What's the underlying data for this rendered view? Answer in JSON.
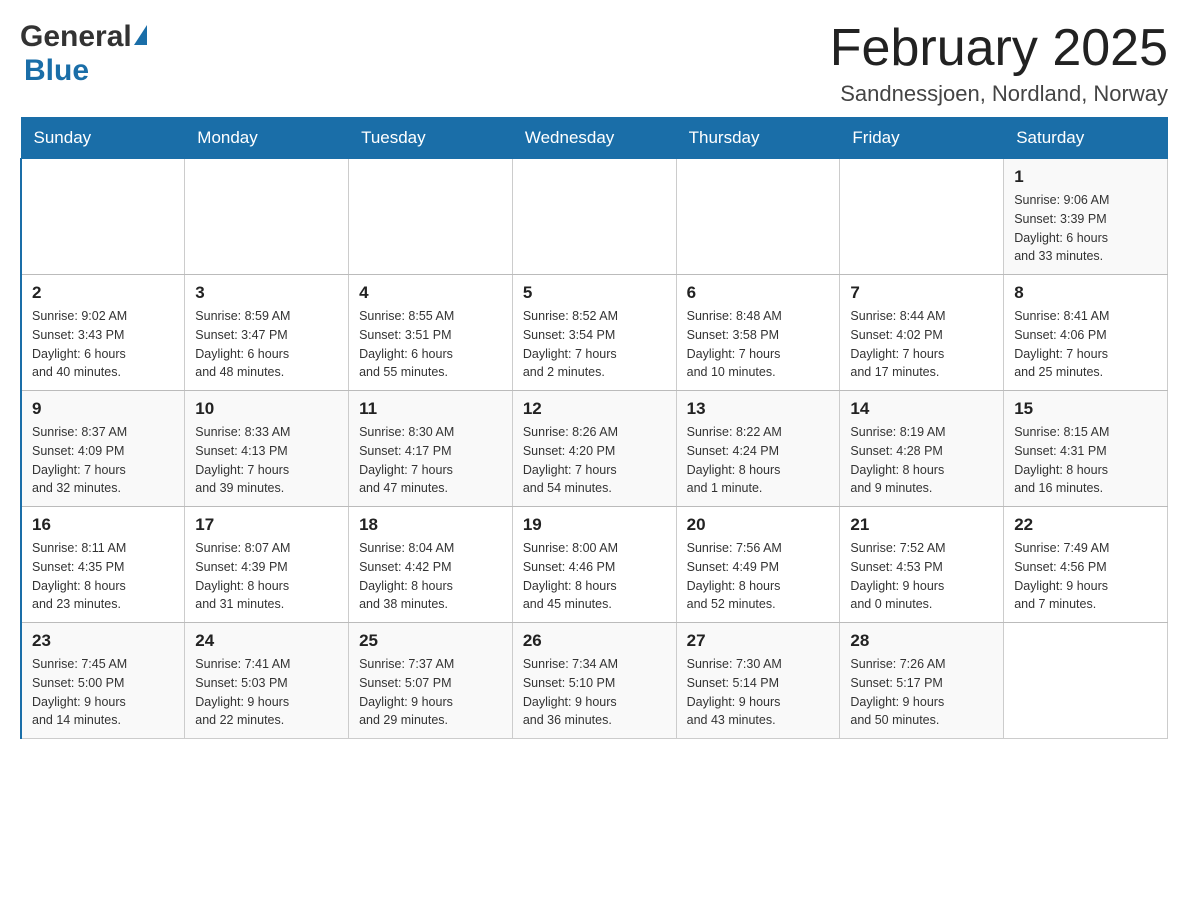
{
  "header": {
    "logo_general": "General",
    "logo_blue": "Blue",
    "title": "February 2025",
    "subtitle": "Sandnessjoen, Nordland, Norway"
  },
  "days_of_week": [
    "Sunday",
    "Monday",
    "Tuesday",
    "Wednesday",
    "Thursday",
    "Friday",
    "Saturday"
  ],
  "weeks": [
    [
      {
        "day": "",
        "info": ""
      },
      {
        "day": "",
        "info": ""
      },
      {
        "day": "",
        "info": ""
      },
      {
        "day": "",
        "info": ""
      },
      {
        "day": "",
        "info": ""
      },
      {
        "day": "",
        "info": ""
      },
      {
        "day": "1",
        "info": "Sunrise: 9:06 AM\nSunset: 3:39 PM\nDaylight: 6 hours\nand 33 minutes."
      }
    ],
    [
      {
        "day": "2",
        "info": "Sunrise: 9:02 AM\nSunset: 3:43 PM\nDaylight: 6 hours\nand 40 minutes."
      },
      {
        "day": "3",
        "info": "Sunrise: 8:59 AM\nSunset: 3:47 PM\nDaylight: 6 hours\nand 48 minutes."
      },
      {
        "day": "4",
        "info": "Sunrise: 8:55 AM\nSunset: 3:51 PM\nDaylight: 6 hours\nand 55 minutes."
      },
      {
        "day": "5",
        "info": "Sunrise: 8:52 AM\nSunset: 3:54 PM\nDaylight: 7 hours\nand 2 minutes."
      },
      {
        "day": "6",
        "info": "Sunrise: 8:48 AM\nSunset: 3:58 PM\nDaylight: 7 hours\nand 10 minutes."
      },
      {
        "day": "7",
        "info": "Sunrise: 8:44 AM\nSunset: 4:02 PM\nDaylight: 7 hours\nand 17 minutes."
      },
      {
        "day": "8",
        "info": "Sunrise: 8:41 AM\nSunset: 4:06 PM\nDaylight: 7 hours\nand 25 minutes."
      }
    ],
    [
      {
        "day": "9",
        "info": "Sunrise: 8:37 AM\nSunset: 4:09 PM\nDaylight: 7 hours\nand 32 minutes."
      },
      {
        "day": "10",
        "info": "Sunrise: 8:33 AM\nSunset: 4:13 PM\nDaylight: 7 hours\nand 39 minutes."
      },
      {
        "day": "11",
        "info": "Sunrise: 8:30 AM\nSunset: 4:17 PM\nDaylight: 7 hours\nand 47 minutes."
      },
      {
        "day": "12",
        "info": "Sunrise: 8:26 AM\nSunset: 4:20 PM\nDaylight: 7 hours\nand 54 minutes."
      },
      {
        "day": "13",
        "info": "Sunrise: 8:22 AM\nSunset: 4:24 PM\nDaylight: 8 hours\nand 1 minute."
      },
      {
        "day": "14",
        "info": "Sunrise: 8:19 AM\nSunset: 4:28 PM\nDaylight: 8 hours\nand 9 minutes."
      },
      {
        "day": "15",
        "info": "Sunrise: 8:15 AM\nSunset: 4:31 PM\nDaylight: 8 hours\nand 16 minutes."
      }
    ],
    [
      {
        "day": "16",
        "info": "Sunrise: 8:11 AM\nSunset: 4:35 PM\nDaylight: 8 hours\nand 23 minutes."
      },
      {
        "day": "17",
        "info": "Sunrise: 8:07 AM\nSunset: 4:39 PM\nDaylight: 8 hours\nand 31 minutes."
      },
      {
        "day": "18",
        "info": "Sunrise: 8:04 AM\nSunset: 4:42 PM\nDaylight: 8 hours\nand 38 minutes."
      },
      {
        "day": "19",
        "info": "Sunrise: 8:00 AM\nSunset: 4:46 PM\nDaylight: 8 hours\nand 45 minutes."
      },
      {
        "day": "20",
        "info": "Sunrise: 7:56 AM\nSunset: 4:49 PM\nDaylight: 8 hours\nand 52 minutes."
      },
      {
        "day": "21",
        "info": "Sunrise: 7:52 AM\nSunset: 4:53 PM\nDaylight: 9 hours\nand 0 minutes."
      },
      {
        "day": "22",
        "info": "Sunrise: 7:49 AM\nSunset: 4:56 PM\nDaylight: 9 hours\nand 7 minutes."
      }
    ],
    [
      {
        "day": "23",
        "info": "Sunrise: 7:45 AM\nSunset: 5:00 PM\nDaylight: 9 hours\nand 14 minutes."
      },
      {
        "day": "24",
        "info": "Sunrise: 7:41 AM\nSunset: 5:03 PM\nDaylight: 9 hours\nand 22 minutes."
      },
      {
        "day": "25",
        "info": "Sunrise: 7:37 AM\nSunset: 5:07 PM\nDaylight: 9 hours\nand 29 minutes."
      },
      {
        "day": "26",
        "info": "Sunrise: 7:34 AM\nSunset: 5:10 PM\nDaylight: 9 hours\nand 36 minutes."
      },
      {
        "day": "27",
        "info": "Sunrise: 7:30 AM\nSunset: 5:14 PM\nDaylight: 9 hours\nand 43 minutes."
      },
      {
        "day": "28",
        "info": "Sunrise: 7:26 AM\nSunset: 5:17 PM\nDaylight: 9 hours\nand 50 minutes."
      },
      {
        "day": "",
        "info": ""
      }
    ]
  ]
}
